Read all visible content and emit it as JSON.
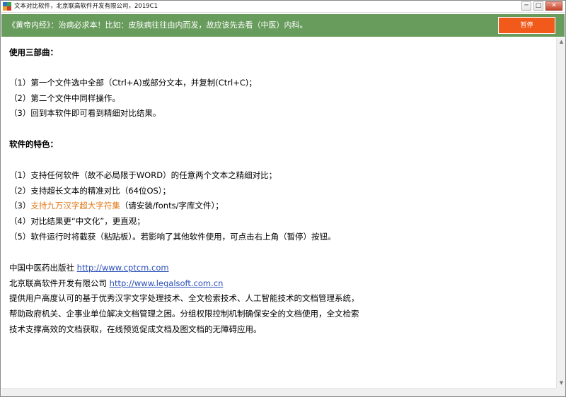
{
  "window": {
    "title": "文本对比软件，北京联高软件开发有限公司，2019C1",
    "controls": {
      "minimize": "─",
      "maximize": "□",
      "close": "✕"
    }
  },
  "banner": {
    "text": "《黄帝内经》：治病必求本！比如：皮肤病往往由内而发，故应该先去看（中医）内科。",
    "pause_label": "暂停",
    "color": "#689c5c",
    "button_color": "#f25a1c"
  },
  "content": {
    "section1": {
      "heading": "使用三部曲：",
      "steps": [
        "（1）第一个文件选中全部（Ctrl+A)或部分文本，并复制(Ctrl+C)；",
        "（2）第二个文件中同样操作。",
        "（3）回到本软件即可看到精细对比结果。"
      ]
    },
    "section2": {
      "heading": "软件的特色：",
      "features": [
        "（1）支持任何软件（故不必局限于WORD）的任意两个文本之精细对比；",
        "（2）支持超长文本的精准对比（64位OS）；",
        {
          "prefix": "（3）",
          "highlight": "支持九万汉字超大字符集",
          "suffix": "（请安装/fonts/字库文件）；"
        },
        "（4）对比结果更“中文化”，更直观；",
        "（5）软件运行时将截获（粘贴板）。若影响了其他软件使用，可点击右上角（暂停）按钮。"
      ],
      "highlight_color": "#e07a1c"
    },
    "footer": {
      "publisher1_name": "中国中医药出版社",
      "publisher1_url": "http://www.cptcm.com",
      "publisher2_name": "北京联高软件开发有限公司",
      "publisher2_url": "http://www.legalsoft.com.cn",
      "description": [
        "提供用户高度认可的基于优秀汉字文字处理技术、全文检索技术、人工智能技术的文档管理系统，",
        "帮助政府机关、企事业单位解决文档管理之困。分组权限控制机制确保安全的文档使用，全文检索",
        "技术支撑高效的文档获取，在线预览促成文档及图文档的无障碍应用。"
      ],
      "link_color": "#2a4fb8"
    }
  },
  "scrollbar": {
    "up_arrow": "▲",
    "down_arrow": "▼"
  }
}
